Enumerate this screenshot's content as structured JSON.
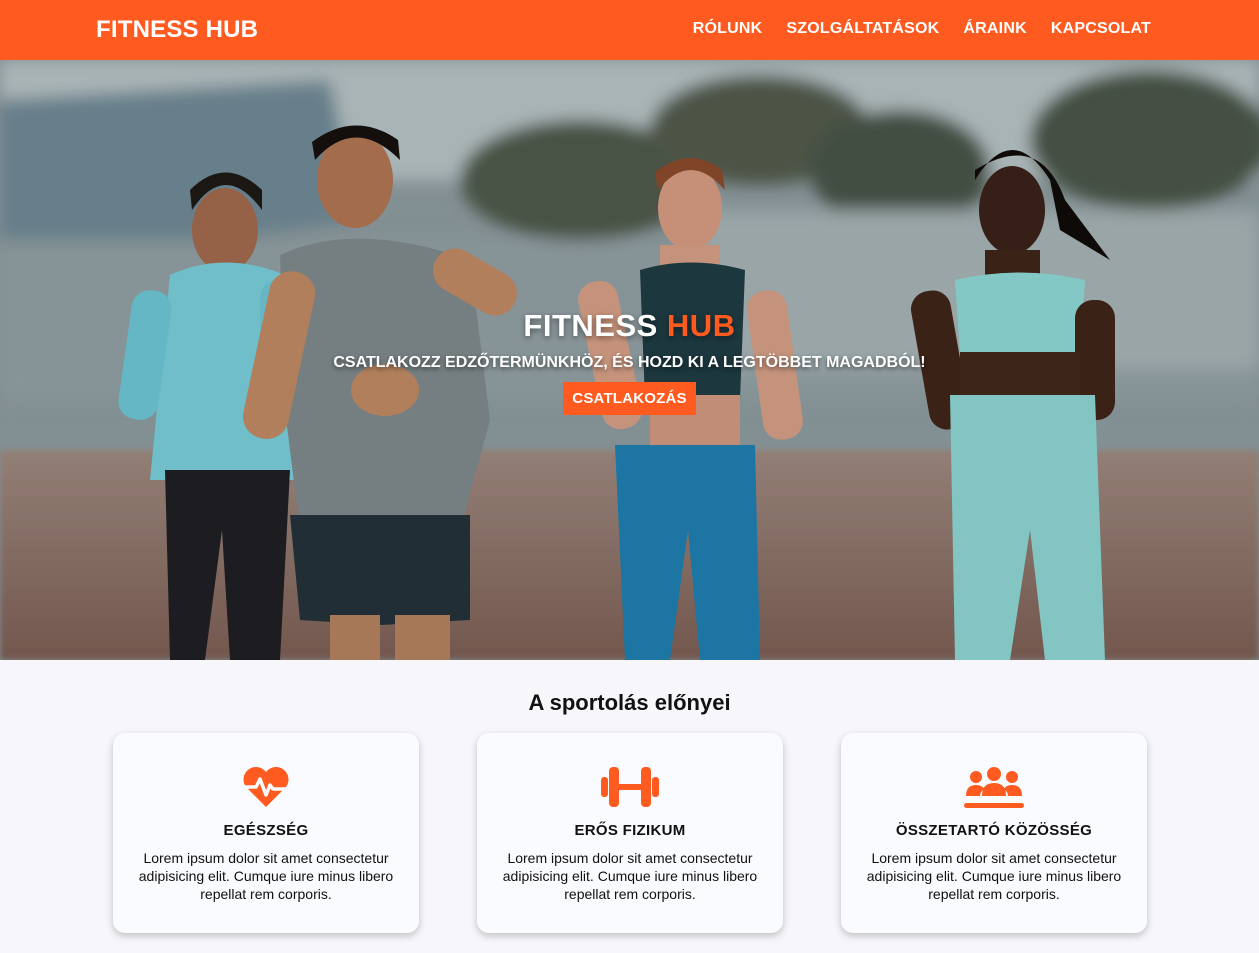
{
  "nav": {
    "brand": "FITNESS HUB",
    "links": [
      "RÓLUNK",
      "SZOLGÁLTATÁSOK",
      "ÁRAINK",
      "KAPCSOLAT"
    ]
  },
  "hero": {
    "title_main": "FITNESS",
    "title_accent": "HUB",
    "subtitle": "CSATLAKOZZ EDZŐTERMÜNKHÖZ, ÉS HOZD KI A LEGTÖBBET MAGADBÓL!",
    "cta": "CSATLAKOZÁS"
  },
  "benefits": {
    "title": "A sportolás előnyei",
    "cards": [
      {
        "icon": "heart-pulse-icon",
        "title": "EGÉSZSÉG",
        "text": "Lorem ipsum dolor sit amet consectetur adipisicing elit. Cumque iure minus libero repellat rem corporis."
      },
      {
        "icon": "dumbbell-icon",
        "title": "ERŐS FIZIKUM",
        "text": "Lorem ipsum dolor sit amet consectetur adipisicing elit. Cumque iure minus libero repellat rem corporis."
      },
      {
        "icon": "people-group-icon",
        "title": "ÖSSZETARTÓ KÖZÖSSÉG",
        "text": "Lorem ipsum dolor sit amet consectetur adipisicing elit. Cumque iure minus libero repellat rem corporis."
      }
    ]
  },
  "colors": {
    "accent": "#ff5a1f",
    "background": "#f7f7fb"
  }
}
